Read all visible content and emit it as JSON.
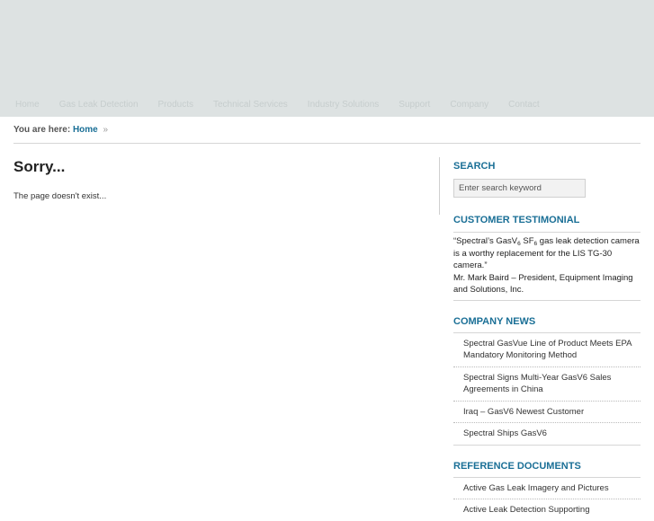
{
  "nav": {
    "items": [
      "Home",
      "Gas Leak Detection",
      "Products",
      "Technical Services",
      "Industry Solutions",
      "Support",
      "Company",
      "Contact"
    ]
  },
  "breadcrumb": {
    "prefix": "You are here:",
    "home": "Home",
    "separator": "»"
  },
  "main": {
    "title": "Sorry...",
    "message": "The page doesn't exist..."
  },
  "search": {
    "heading": "SEARCH",
    "placeholder": "Enter search keyword"
  },
  "testimonial": {
    "heading": "CUSTOMER TESTIMONIAL",
    "quote_open": "“Spectral’s GasV",
    "sub1": "6",
    "mid": " SF",
    "sub2": "6",
    "quote_rest": " gas leak detection camera is a worthy replacement for the LIS TG-30 camera.”",
    "author": "Mr. Mark Baird – President, Equipment Imaging and Solutions, Inc."
  },
  "news": {
    "heading": "COMPANY NEWS",
    "items": [
      "Spectral GasVue Line of Product Meets EPA Mandatory Monitoring Method",
      "Spectral Signs Multi-Year GasV6 Sales Agreements in China",
      "Iraq – GasV6 Newest Customer",
      "Spectral Ships GasV6"
    ]
  },
  "docs": {
    "heading": "REFERENCE DOCUMENTS",
    "items": [
      "Active Gas Leak Imagery and Pictures",
      "Active Leak Detection Supporting"
    ]
  }
}
